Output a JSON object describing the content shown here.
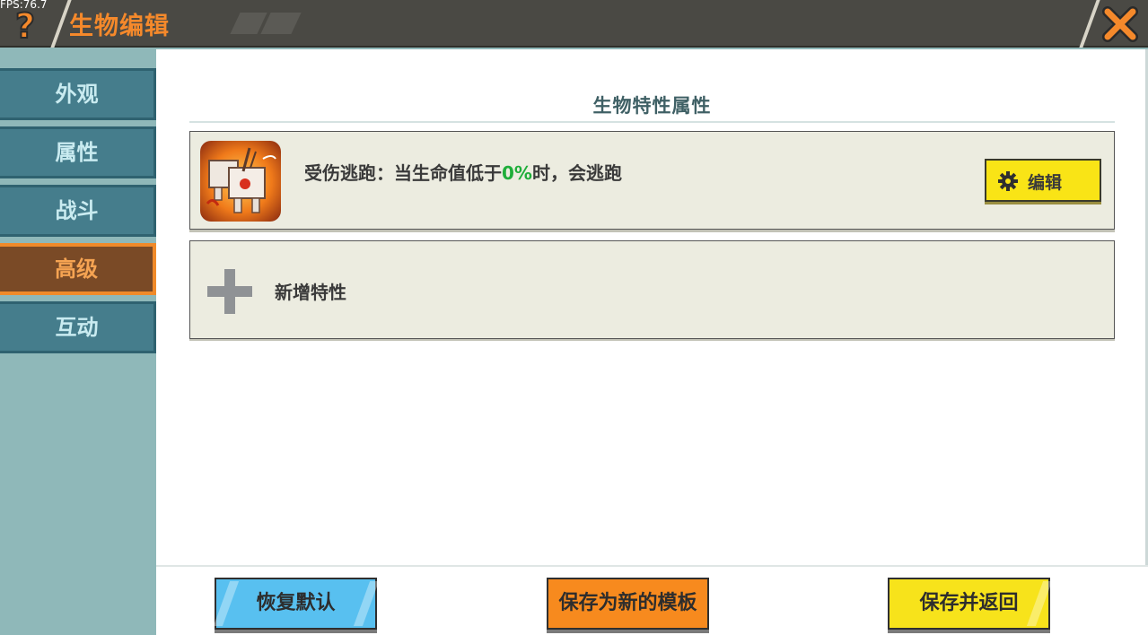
{
  "app": {
    "fps": "FPS:76.7",
    "title": "生物编辑"
  },
  "sidebar": {
    "items": [
      {
        "label": "外观",
        "active": false
      },
      {
        "label": "属性",
        "active": false
      },
      {
        "label": "战斗",
        "active": false
      },
      {
        "label": "高级",
        "active": true
      },
      {
        "label": "互动",
        "active": false
      }
    ]
  },
  "main": {
    "section_title": "生物特性属性",
    "trait": {
      "text_prefix": "受伤逃跑：当生命值低于",
      "value": "0%",
      "text_suffix": "时，会逃跑",
      "icon": "fleeing-creature-icon",
      "edit_label": "编辑"
    },
    "add_trait_label": "新增特性"
  },
  "footer": {
    "reset_label": "恢复默认",
    "save_template_label": "保存为新的模板",
    "save_return_label": "保存并返回"
  },
  "colors": {
    "accent": "#f5892b",
    "sidebar_active": "#7a4a26",
    "sidebar_item": "#457d8c",
    "highlight_value": "#1fae3a",
    "edit_button": "#f9e416"
  }
}
